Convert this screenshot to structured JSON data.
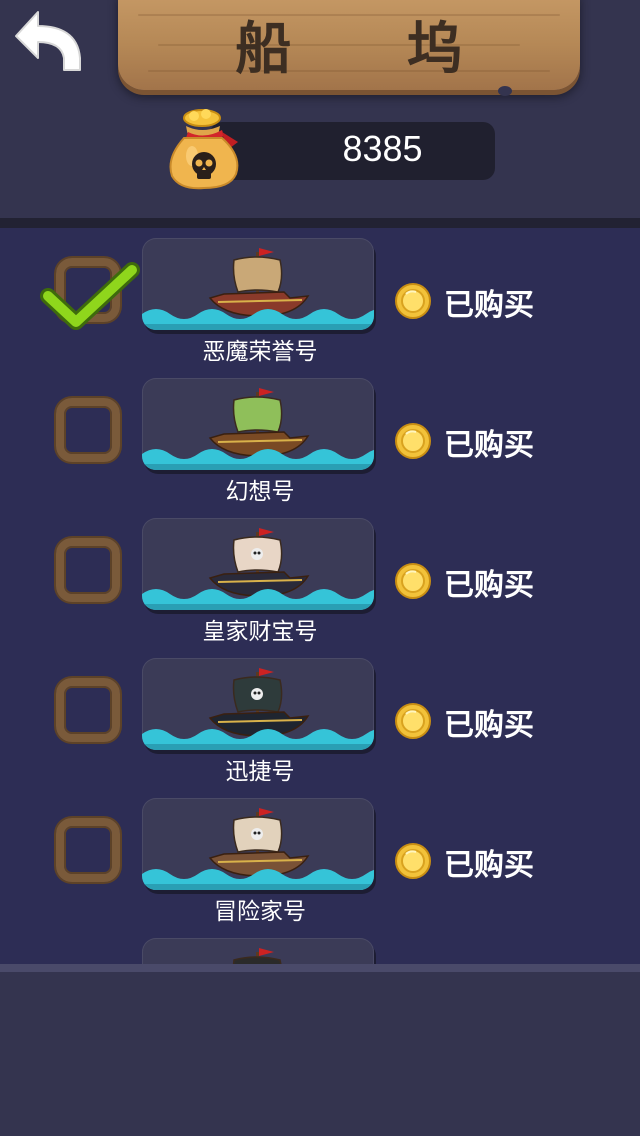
{
  "header": {
    "title": "船 坞",
    "coins": "8385",
    "back_icon": "back-arrow-icon",
    "bag_icon": "money-bag-skull-icon"
  },
  "ships": [
    {
      "name": "恶魔荣誉号",
      "status": "已购买",
      "selected": true,
      "sail_color": "#c9a877",
      "hull_color": "#8a3a2a"
    },
    {
      "name": "幻想号",
      "status": "已购买",
      "selected": false,
      "sail_color": "#8fbf5a",
      "hull_color": "#7a4a24"
    },
    {
      "name": "皇家财宝号",
      "status": "已购买",
      "selected": false,
      "sail_color": "#e8d6c6",
      "hull_color": "#2a2a3a"
    },
    {
      "name": "迅捷号",
      "status": "已购买",
      "selected": false,
      "sail_color": "#2e3b3b",
      "hull_color": "#1f2530"
    },
    {
      "name": "冒险家号",
      "status": "已购买",
      "selected": false,
      "sail_color": "#e2d2bc",
      "hull_color": "#7a5236"
    },
    {
      "name": "",
      "status": "",
      "selected": false,
      "sail_color": "#2a2a2a",
      "hull_color": "#2a2a2a"
    }
  ],
  "colors": {
    "background": "#34344f",
    "list_background": "#2d2d55",
    "wave": "#35c4d8",
    "check": "#8fd61c",
    "checkbox_border": "#7a5a3a",
    "coin_gold": "#f2c23a"
  }
}
